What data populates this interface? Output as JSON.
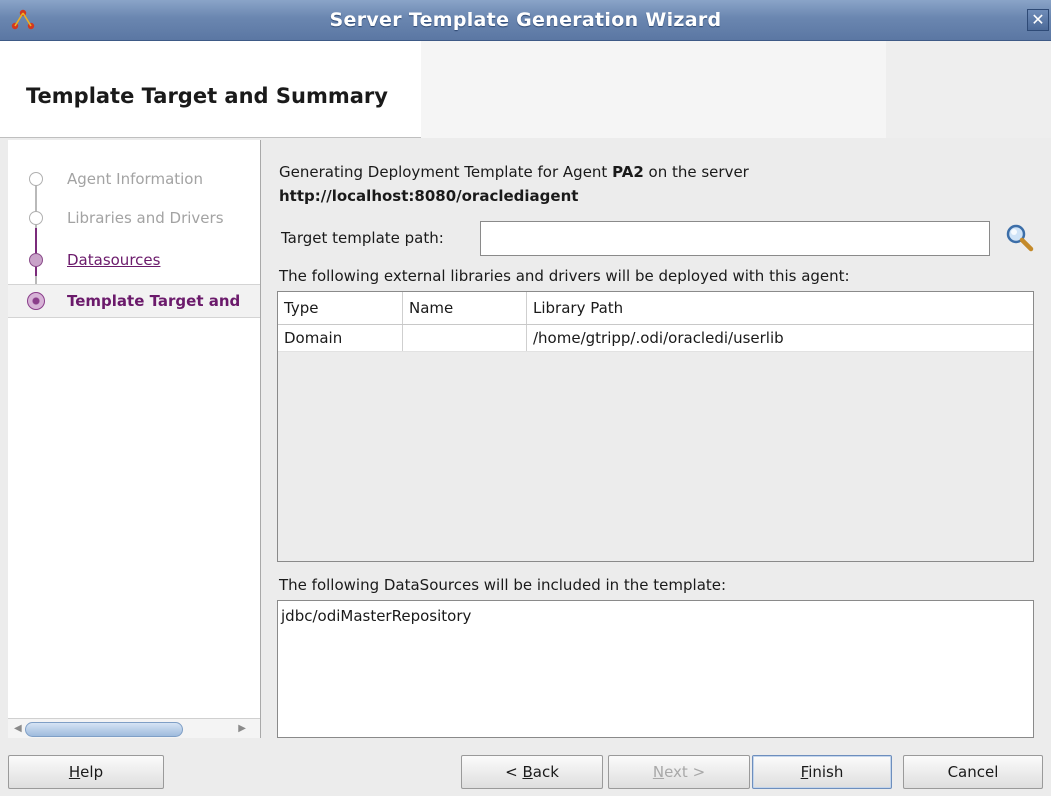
{
  "window": {
    "title": "Server Template Generation Wizard",
    "close_glyph": "✕"
  },
  "header": {
    "title": "Template Target and Summary"
  },
  "nav": {
    "steps": [
      {
        "label": "Agent Information",
        "state": "inactive"
      },
      {
        "label": "Libraries and Drivers",
        "state": "inactive"
      },
      {
        "label": "Datasources",
        "state": "visited"
      },
      {
        "label": "Template Target and",
        "state": "current"
      }
    ]
  },
  "main": {
    "intro_prefix": "Generating Deployment Template for Agent ",
    "agent_name": "PA2",
    "intro_suffix": " on the server",
    "server_url": "http://localhost:8080/oraclediagent",
    "target_path_label": "Target template path:",
    "target_path_value": "",
    "libs_label": "The following external libraries and drivers will be deployed with this agent:",
    "libs_table": {
      "columns": [
        "Type",
        "Name",
        "Library Path"
      ],
      "rows": [
        [
          "Domain",
          "",
          "/home/gtripp/.odi/oracledi/userlib"
        ]
      ]
    },
    "datasources_label": "The following DataSources will be included in the template:",
    "datasources": [
      "jdbc/odiMasterRepository"
    ]
  },
  "buttons": {
    "help": {
      "mnemonic": "H",
      "rest": "elp"
    },
    "back": {
      "prefix": "< ",
      "mnemonic": "B",
      "rest": "ack"
    },
    "next": {
      "mnemonic": "N",
      "rest": "ext >"
    },
    "finish": {
      "mnemonic": "F",
      "rest": "inish"
    },
    "cancel": "Cancel"
  },
  "colors": {
    "titlebar": "#6a86b0",
    "train_accent": "#7b2b7b"
  }
}
